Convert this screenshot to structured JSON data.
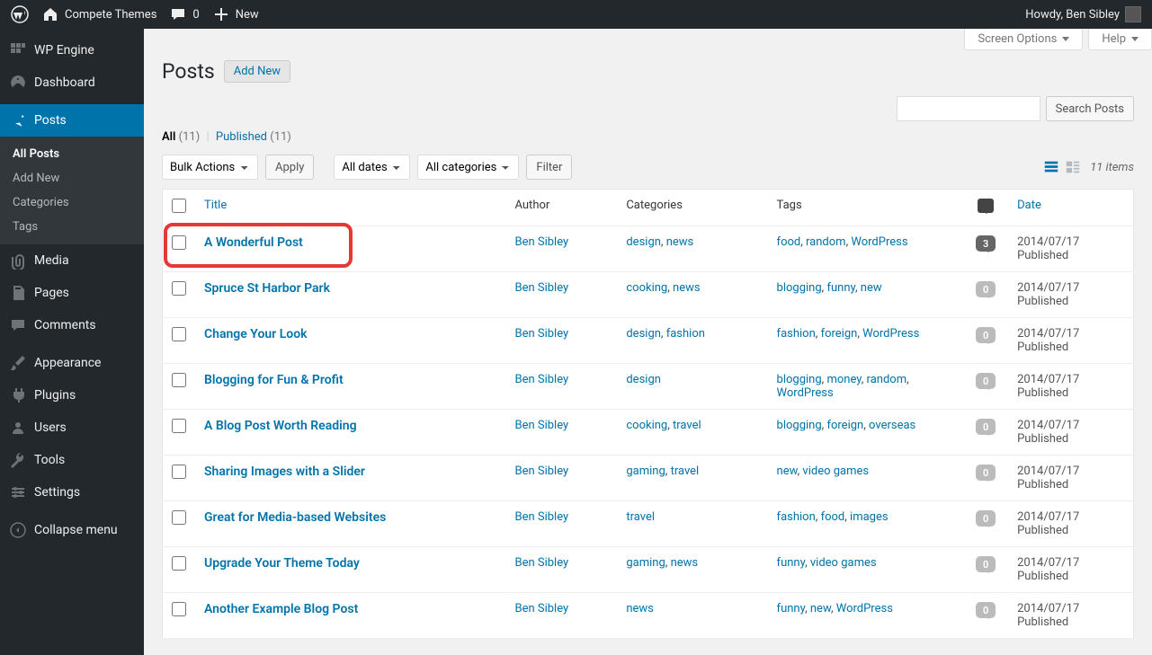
{
  "adminBar": {
    "siteName": "Compete Themes",
    "commentsCount": "0",
    "newLabel": "New",
    "greeting": "Howdy, Ben Sibley"
  },
  "sidebar": {
    "wpengine": "WP Engine",
    "dashboard": "Dashboard",
    "posts": "Posts",
    "postsSub": {
      "all": "All Posts",
      "addNew": "Add New",
      "categories": "Categories",
      "tags": "Tags"
    },
    "media": "Media",
    "pages": "Pages",
    "comments": "Comments",
    "appearance": "Appearance",
    "plugins": "Plugins",
    "users": "Users",
    "tools": "Tools",
    "settings": "Settings",
    "collapse": "Collapse menu"
  },
  "screenMeta": {
    "screenOptions": "Screen Options",
    "help": "Help"
  },
  "heading": "Posts",
  "addNewBtn": "Add New",
  "filters": {
    "all": "All",
    "allCount": "(11)",
    "published": "Published",
    "publishedCount": "(11)"
  },
  "bulkActions": "Bulk Actions",
  "apply": "Apply",
  "allDates": "All dates",
  "allCategories": "All categories",
  "filterBtn": "Filter",
  "searchBtn": "Search Posts",
  "itemsCount": "11 items",
  "columns": {
    "title": "Title",
    "author": "Author",
    "categories": "Categories",
    "tags": "Tags",
    "date": "Date"
  },
  "posts": [
    {
      "title": "A Wonderful Post",
      "author": "Ben Sibley",
      "categories": [
        "design",
        "news"
      ],
      "tags": [
        "food",
        "random",
        "WordPress"
      ],
      "comments": "3",
      "date": "2014/07/17",
      "status": "Published"
    },
    {
      "title": "Spruce St Harbor Park",
      "author": "Ben Sibley",
      "categories": [
        "cooking",
        "news"
      ],
      "tags": [
        "blogging",
        "funny",
        "new"
      ],
      "comments": "0",
      "date": "2014/07/17",
      "status": "Published"
    },
    {
      "title": "Change Your Look",
      "author": "Ben Sibley",
      "categories": [
        "design",
        "fashion"
      ],
      "tags": [
        "fashion",
        "foreign",
        "WordPress"
      ],
      "comments": "0",
      "date": "2014/07/17",
      "status": "Published"
    },
    {
      "title": "Blogging for Fun & Profit",
      "author": "Ben Sibley",
      "categories": [
        "design"
      ],
      "tags": [
        "blogging",
        "money",
        "random",
        "WordPress"
      ],
      "comments": "0",
      "date": "2014/07/17",
      "status": "Published"
    },
    {
      "title": "A Blog Post Worth Reading",
      "author": "Ben Sibley",
      "categories": [
        "cooking",
        "travel"
      ],
      "tags": [
        "blogging",
        "foreign",
        "overseas"
      ],
      "comments": "0",
      "date": "2014/07/17",
      "status": "Published"
    },
    {
      "title": "Sharing Images with a Slider",
      "author": "Ben Sibley",
      "categories": [
        "gaming",
        "travel"
      ],
      "tags": [
        "new",
        "video games"
      ],
      "comments": "0",
      "date": "2014/07/17",
      "status": "Published"
    },
    {
      "title": "Great for Media-based Websites",
      "author": "Ben Sibley",
      "categories": [
        "travel"
      ],
      "tags": [
        "fashion",
        "food",
        "images"
      ],
      "comments": "0",
      "date": "2014/07/17",
      "status": "Published"
    },
    {
      "title": "Upgrade Your Theme Today",
      "author": "Ben Sibley",
      "categories": [
        "gaming",
        "news"
      ],
      "tags": [
        "funny",
        "video games"
      ],
      "comments": "0",
      "date": "2014/07/17",
      "status": "Published"
    },
    {
      "title": "Another Example Blog Post",
      "author": "Ben Sibley",
      "categories": [
        "news"
      ],
      "tags": [
        "funny",
        "new",
        "WordPress"
      ],
      "comments": "0",
      "date": "2014/07/17",
      "status": "Published"
    }
  ]
}
